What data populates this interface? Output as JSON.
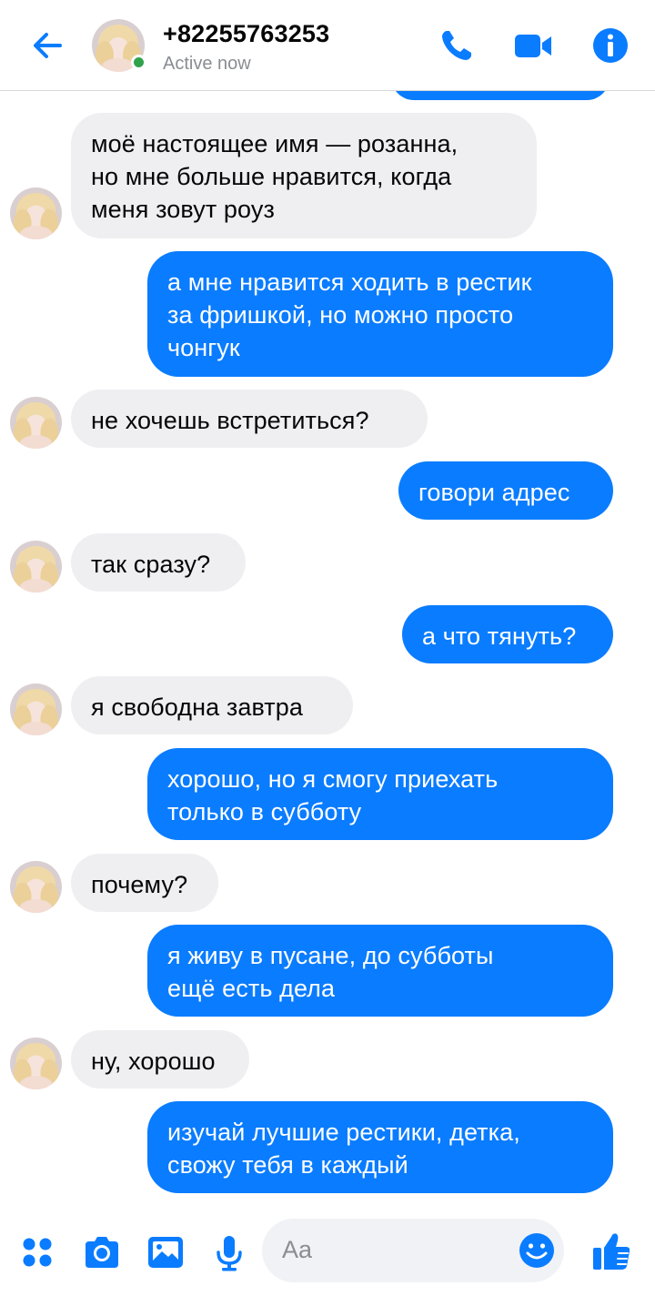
{
  "header": {
    "contact_name": "+82255763253",
    "status": "Active now",
    "icons": [
      "back-arrow-icon",
      "phone-icon",
      "video-camera-icon",
      "info-icon"
    ]
  },
  "messages": [
    {
      "side": "in",
      "text": "моё настоящее имя — розанна,\nно мне больше нравится, когда\nменя зовут роуз"
    },
    {
      "side": "out",
      "text": "а мне нравится ходить в рестик\nза фришкой, но можно просто\nчонгук"
    },
    {
      "side": "in",
      "text": "не хочешь встретиться?"
    },
    {
      "side": "out",
      "text": "говори адрес"
    },
    {
      "side": "in",
      "text": "так сразу?"
    },
    {
      "side": "out",
      "text": "а что тянуть?"
    },
    {
      "side": "in",
      "text": "я свободна завтра"
    },
    {
      "side": "out",
      "text": "хорошо, но я смогу приехать\nтолько в субботу"
    },
    {
      "side": "in",
      "text": "почему?"
    },
    {
      "side": "out",
      "text": "я живу в пусане, до субботы\nещё есть дела"
    },
    {
      "side": "in",
      "text": "ну, хорошо"
    },
    {
      "side": "out",
      "text": "изучай лучшие рестики, детка,\nсвожу тебя в каждый"
    }
  ],
  "composer": {
    "placeholder": "Aa",
    "icons": [
      "menu-dots-icon",
      "camera-icon",
      "gallery-icon",
      "microphone-icon",
      "emoji-icon",
      "like-thumb-icon"
    ]
  },
  "colors": {
    "accent": "#0a7cff",
    "incoming_bubble": "#efeff2",
    "online": "#31a24c"
  }
}
